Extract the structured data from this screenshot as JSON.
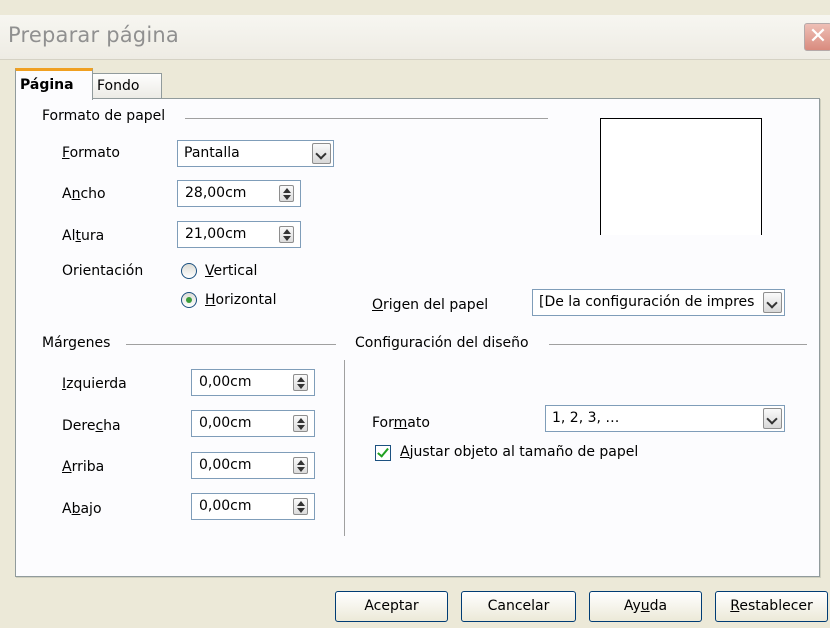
{
  "window": {
    "title": "Preparar página",
    "close_icon": "close-icon"
  },
  "tabs": [
    {
      "label": "Página",
      "active": true
    },
    {
      "label": "Fondo",
      "active": false
    }
  ],
  "paper_format": {
    "heading": "Formato de papel",
    "format_label": "Formato",
    "format_value": "Pantalla",
    "width_label": "Ancho",
    "width_value": "28,00cm",
    "height_label": "Altura",
    "height_value": "21,00cm",
    "orientation_label": "Orientación",
    "portrait_label": "Vertical",
    "landscape_label": "Horizontal",
    "orientation_selected": "Horizontal",
    "paper_source_label": "Origen del papel",
    "paper_source_value": "[De la configuración de impres"
  },
  "margins": {
    "heading": "Márgenes",
    "left_label": "Izquierda",
    "left_value": "0,00cm",
    "right_label": "Derecha",
    "right_value": "0,00cm",
    "top_label": "Arriba",
    "top_value": "0,00cm",
    "bottom_label": "Abajo",
    "bottom_value": "0,00cm"
  },
  "layout": {
    "heading": "Configuración del diseño",
    "format_label": "Formato",
    "format_value": "1, 2, 3, …",
    "fit_label": "Ajustar objeto al tamaño de papel",
    "fit_checked": true
  },
  "buttons": {
    "ok": "Aceptar",
    "cancel": "Cancelar",
    "help": "Ayuda",
    "reset": "Restablecer"
  }
}
